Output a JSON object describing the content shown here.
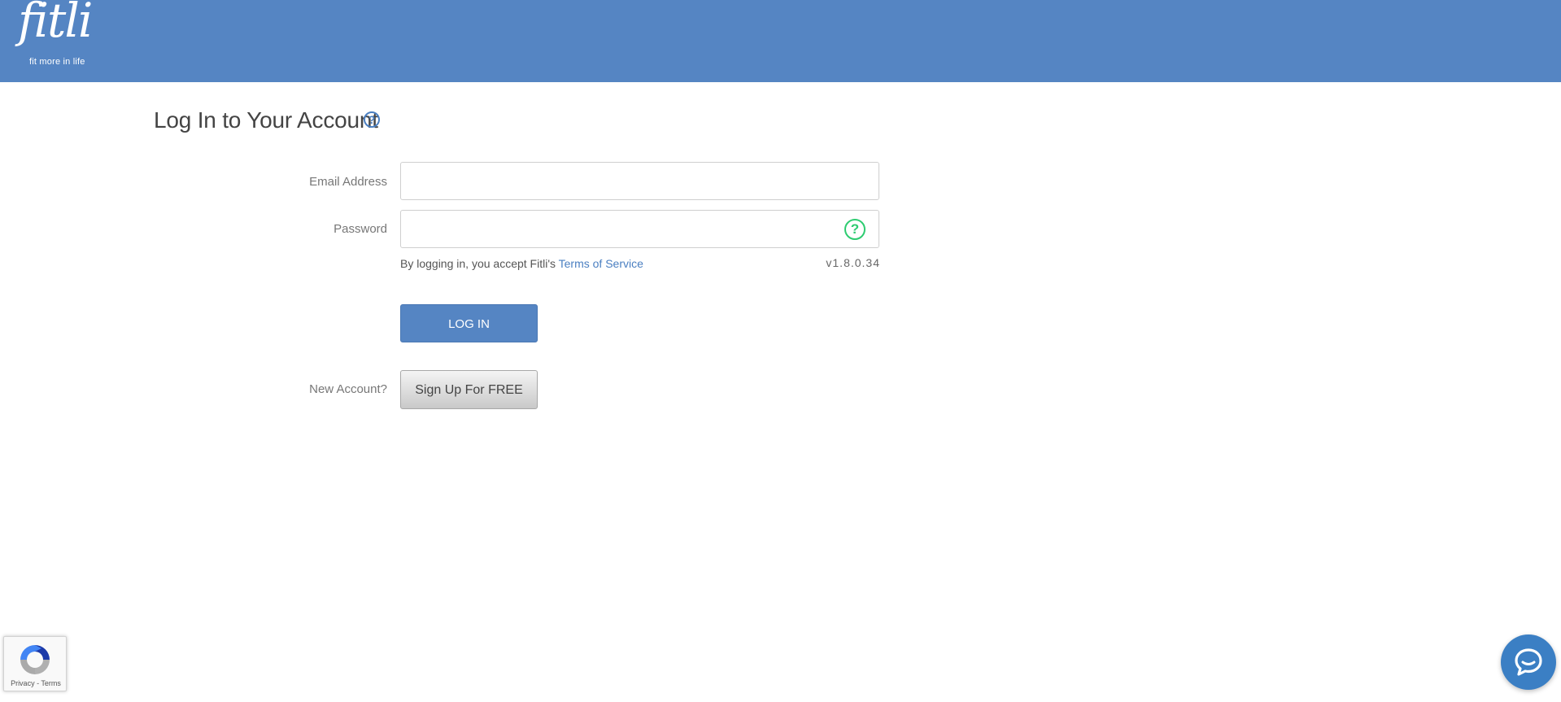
{
  "header": {
    "logo_word": "fitli",
    "logo_tagline": "fit more in life",
    "background_color": "#5585c3"
  },
  "login": {
    "title": "Log In to Your Account",
    "title_help_icon": "question-circle-icon",
    "email_label": "Email Address",
    "email_value": "",
    "password_label": "Password",
    "password_value": "",
    "password_help_icon": "question-circle-icon",
    "terms_prefix": "By logging in, you accept Fitli's",
    "terms_link": "Terms of Service",
    "version": "v1.8.0.34",
    "login_button": "LOG IN",
    "new_account_label": "New Account?",
    "signup_button": "Sign Up For FREE"
  },
  "recaptcha": {
    "privacy": "Privacy",
    "separator": " - ",
    "terms": "Terms",
    "icon": "recaptcha-icon"
  },
  "chat": {
    "icon": "chat-bubble-icon",
    "color": "#3b7fc4"
  }
}
